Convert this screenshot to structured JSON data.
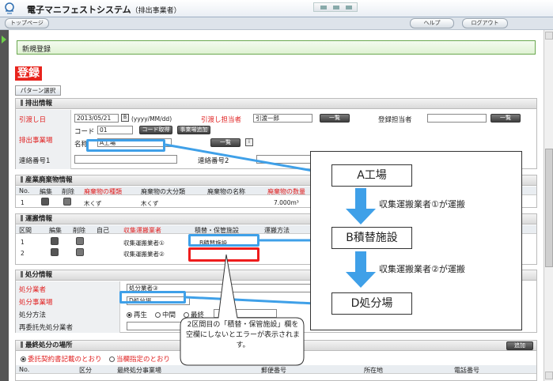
{
  "header": {
    "title": "電子マニフェストシステム",
    "subtitle": "（排出事業者）"
  },
  "nav": {
    "top_page": "トップページ",
    "help": "ヘルプ",
    "logout": "ログアウト"
  },
  "page_title": "新規登録",
  "register_label": "登録",
  "pattern_select": "パターン選択",
  "discharge": {
    "section_title": "排出情報",
    "delivery_date_label": "引渡し日",
    "delivery_date_value": "2013/05/21",
    "date_format_hint": "(yyyy/MM/dd)",
    "delivery_person_label": "引渡し担当者",
    "delivery_person_value": "引渡一郎",
    "list_btn": "一覧",
    "registrant_label": "登録担当者",
    "site_label": "排出事業場",
    "code_label": "コード",
    "code_value": "01",
    "code_fetch_btn": "コード取得",
    "site_add_btn": "事業場追加",
    "name_label": "名称",
    "name_value": "A工場",
    "contact1_label": "連絡番号1",
    "contact2_label": "連絡番号2"
  },
  "waste": {
    "section_title": "産業廃棄物情報",
    "headers": [
      "No.",
      "編集",
      "削除",
      "廃棄物の種類",
      "廃棄物の大分類",
      "廃棄物の名称",
      "廃棄物の数量"
    ],
    "row": {
      "no": "1",
      "kind": "木くず",
      "major": "木くず",
      "name": "",
      "qty": "7.000m³"
    }
  },
  "transport": {
    "section_title": "運搬情報",
    "headers": [
      "区間",
      "編集",
      "削除",
      "自己",
      "収集運搬業者",
      "積替・保管施設",
      "運搬方法"
    ],
    "rows": [
      {
        "no": "1",
        "carrier": "収集運搬業者①",
        "facility": "B積替施設"
      },
      {
        "no": "2",
        "carrier": "収集運搬業者②",
        "facility": ""
      }
    ]
  },
  "disposal": {
    "section_title": "処分情報",
    "company_label": "処分業者",
    "company_value": "処分業者③",
    "site_label": "処分事業場",
    "site_value": "D処分場",
    "method_label": "処分方法",
    "method_options": [
      "再生",
      "中間",
      "最終"
    ],
    "reconsign_label": "再委託先処分業者"
  },
  "final": {
    "section_title": "最終処分の場所",
    "option1": "委託契約書記載のとおり",
    "option2": "当欄指定のとおり",
    "add_btn": "追加",
    "headers": [
      "No.",
      "区分",
      "最終処分事業場",
      "郵便番号",
      "所在地",
      "電話番号"
    ]
  },
  "annotations": {
    "step_a": "A工場",
    "arrow1": "収集運搬業者①が運搬",
    "step_b": "B積替施設",
    "arrow2": "収集運搬業者②が運搬",
    "step_d": "D処分場",
    "callout": "2区間目の「積替・保管施設」欄を空欄にしないとエラーが表示されます。"
  },
  "colors": {
    "highlight_blue": "#3fa0e8",
    "highlight_red": "#ee1c1c",
    "flow_arrow": "#3fa0e8",
    "title_bar_green": "#6aa84f",
    "register_red": "#e8231c"
  }
}
